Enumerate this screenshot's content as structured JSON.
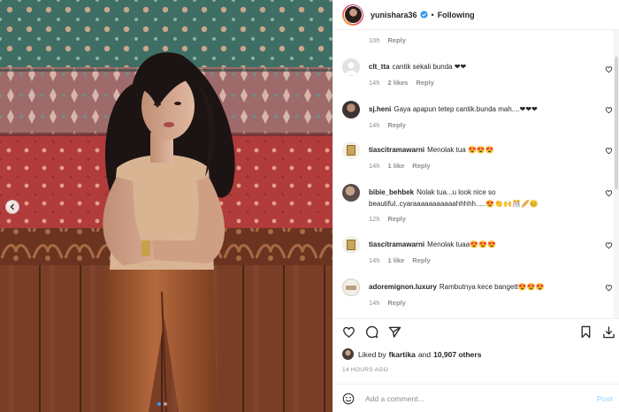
{
  "header": {
    "username": "yunishara36",
    "separator": "•",
    "follow_label": "Following",
    "verified_color": "#3897f0"
  },
  "previous_comment_meta": {
    "time": "10h",
    "reply": "Reply"
  },
  "comments": [
    {
      "username": "clt_tta",
      "text": "cantik sekali bunda ❤❤",
      "time": "14h",
      "likes": "2 likes",
      "reply": "Reply",
      "avatar": "default-avatar-icon"
    },
    {
      "username": "sj.heni",
      "text": "Gaya apapun tetep cantik.bunda mah....❤❤❤",
      "time": "14h",
      "likes": "",
      "reply": "Reply",
      "avatar": "profile-photo"
    },
    {
      "username": "tiascitramawarni",
      "text": "Menolak tua 😍😍😍",
      "time": "14h",
      "likes": "1 like",
      "reply": "Reply",
      "avatar": "board-avatar"
    },
    {
      "username": "bibie_behbek",
      "text": "Nolak tua...u look nice so beautiful..cyaraaaaaaaaaaahhhhh.....😍👏🙌🎊🥖😊",
      "time": "12h",
      "likes": "",
      "reply": "Reply",
      "avatar": "profile-photo"
    },
    {
      "username": "tiascitramawarni",
      "text": "Menolak tuaa😍😍😍",
      "time": "14h",
      "likes": "1 like",
      "reply": "Reply",
      "avatar": "board-avatar"
    },
    {
      "username": "adoremignon.luxury",
      "text": "Rambutnya kece bangett😍😍😍",
      "time": "14h",
      "likes": "",
      "reply": "Reply",
      "avatar": "logo-avatar"
    }
  ],
  "actions": {
    "like_icon": "heart-icon",
    "comment_icon": "comment-icon",
    "share_icon": "share-icon",
    "save_icon": "bookmark-icon",
    "download_icon": "download-icon"
  },
  "likes": {
    "prefix": "Liked by",
    "user": "fkartika",
    "conjunction": "and",
    "count": "10,907 others"
  },
  "timestamp": "14 HOURS AGO",
  "add_comment": {
    "placeholder": "Add a comment...",
    "post_label": "Post"
  },
  "colors": {
    "heart_red": "#ed4956",
    "link_blue": "#3897f0",
    "post_disabled": "#b2dffc"
  }
}
